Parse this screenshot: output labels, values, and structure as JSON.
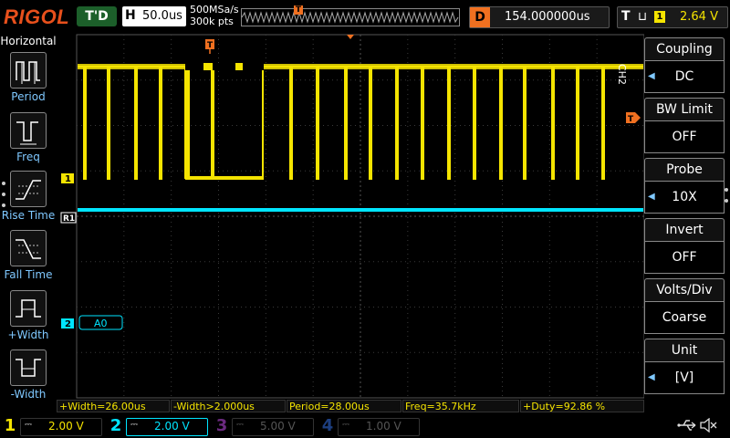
{
  "brand": "RIGOL",
  "run_status": "T'D",
  "timebase": {
    "letter": "H",
    "value": "50.0us"
  },
  "sample": {
    "rate": "500MSa/s",
    "points": "300k pts"
  },
  "delay": {
    "letter": "D",
    "value": "154.000000us"
  },
  "trigger": {
    "letter": "T",
    "edge": "⊔",
    "source": "1",
    "level": "2.64 V"
  },
  "trigger_marker": "T",
  "left_menu": {
    "title": "Horizontal",
    "items": [
      {
        "label": "Period",
        "icon": "period-icon"
      },
      {
        "label": "Freq",
        "icon": "freq-icon"
      },
      {
        "label": "Rise Time",
        "icon": "rise-time-icon"
      },
      {
        "label": "Fall Time",
        "icon": "fall-time-icon"
      },
      {
        "label": "+Width",
        "icon": "pos-width-icon"
      },
      {
        "label": "-Width",
        "icon": "neg-width-icon"
      }
    ]
  },
  "right_menu": {
    "channel_tag": "CH2",
    "items": [
      {
        "title": "Coupling",
        "value": "DC"
      },
      {
        "title": "BW Limit",
        "value": "OFF"
      },
      {
        "title": "Probe",
        "value": "10X"
      },
      {
        "title": "Invert",
        "value": "OFF"
      },
      {
        "title": "Volts/Div",
        "value": "Coarse"
      },
      {
        "title": "Unit",
        "value": "[V]"
      }
    ]
  },
  "markers": {
    "ch1": "1",
    "ref": "R1",
    "ch2": "2",
    "ch2_label": "A0",
    "trigger_level": "T"
  },
  "measurements": [
    "+Width=26.00us",
    "-Width>2.000us",
    "Period=28.00us",
    "Freq=35.7kHz",
    "+Duty=92.86 %"
  ],
  "channels": [
    {
      "num": "1",
      "coupling": "⎓",
      "scale": "2.00 V",
      "color": "#f5e400"
    },
    {
      "num": "2",
      "coupling": "⎓",
      "scale": "2.00 V",
      "color": "#00e5ff"
    },
    {
      "num": "3",
      "coupling": "⎓",
      "scale": "5.00 V",
      "color": "#b23ad8"
    },
    {
      "num": "4",
      "coupling": "⎓",
      "scale": "1.00 V",
      "color": "#2860d0"
    }
  ],
  "colors": {
    "ch1": "#f5e400",
    "ch2": "#00e5ff",
    "accent": "#f07020"
  },
  "status_icons": [
    "usb-icon",
    "speaker-muted-icon"
  ]
}
